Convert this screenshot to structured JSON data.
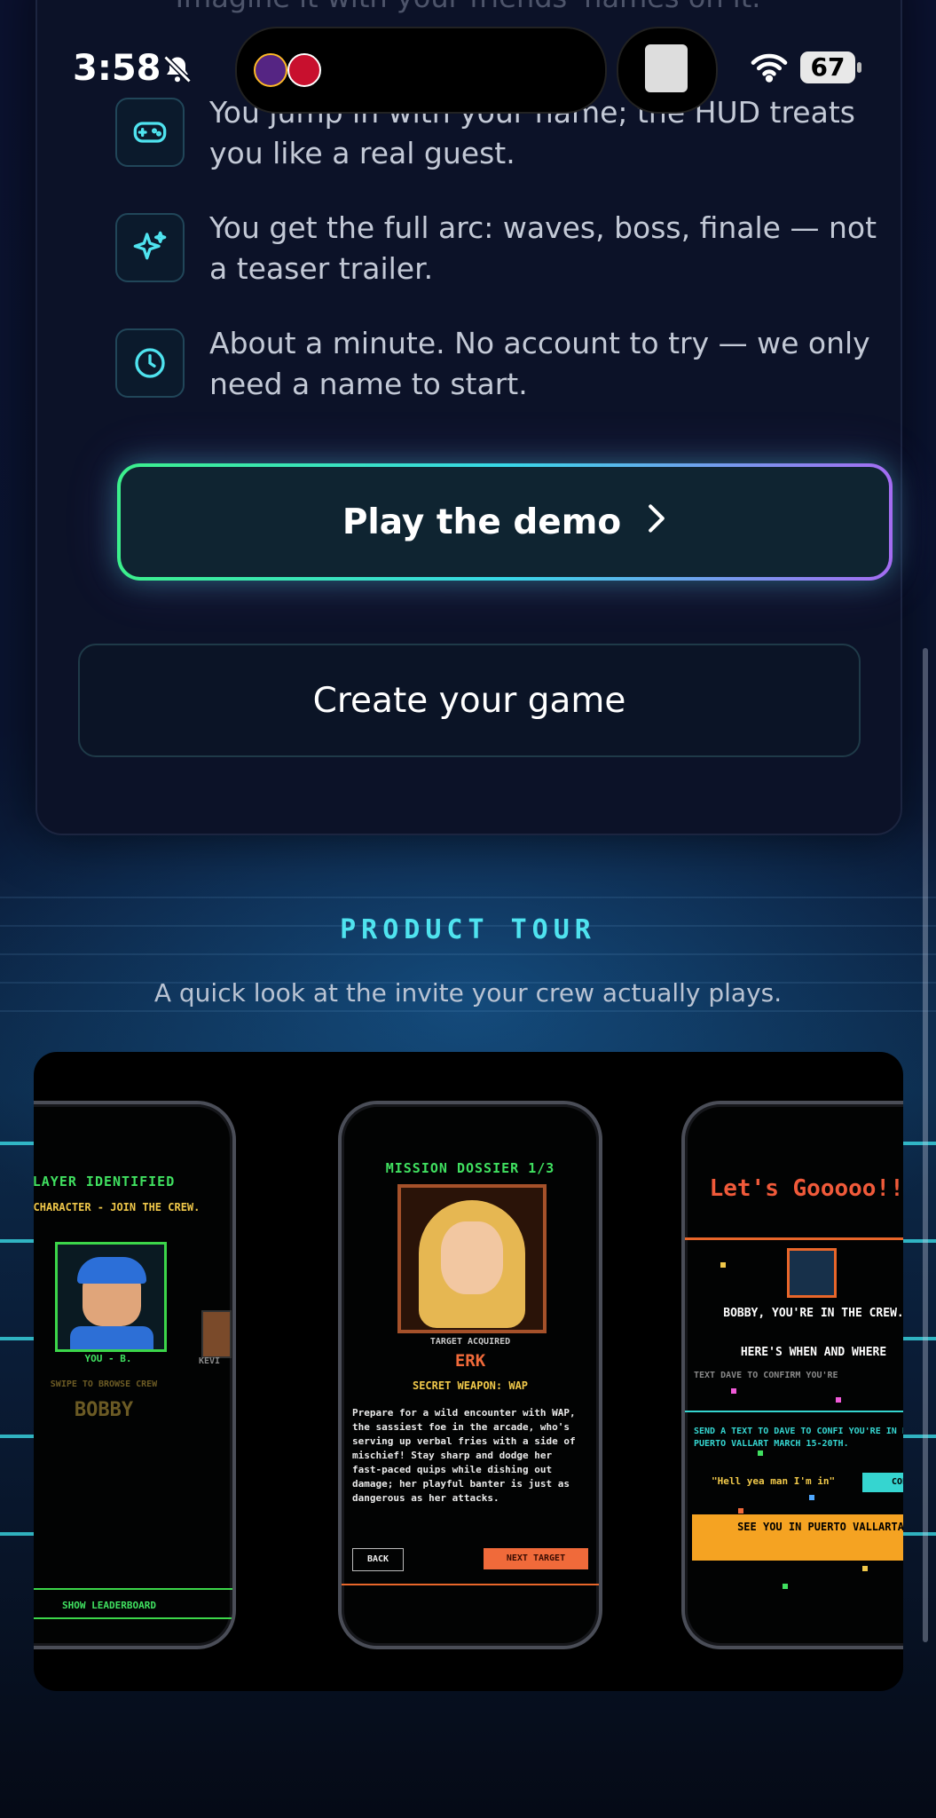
{
  "status_bar": {
    "time": "3:58",
    "battery": "67",
    "ghost_text": "Imagine it with your friends' names on it."
  },
  "features": [
    {
      "icon": "gamepad-icon",
      "text": "You jump in with your name; the HUD treats you like a real guest."
    },
    {
      "icon": "sparkles-icon",
      "text": "You get the full arc: waves, boss, finale — not a teaser trailer."
    },
    {
      "icon": "clock-icon",
      "text": "About a minute. No account to try — we only need a name to start."
    }
  ],
  "buttons": {
    "play_demo": "Play the demo",
    "create_game": "Create your game"
  },
  "tour": {
    "label": "PRODUCT TOUR",
    "subtitle": "A quick look at the invite your crew actually plays."
  },
  "phones": {
    "p1": {
      "title": "LAYER IDENTIFIED",
      "subtitle": "OUR CHARACTER - JOIN THE CREW.",
      "you_label": "YOU - B.",
      "kev_label": "KEVI",
      "swipe": "SWIPE TO BROWSE CREW",
      "name": "BOBBY",
      "leaderboard": "SHOW LEADERBOARD"
    },
    "p2": {
      "title": "MISSION DOSSIER 1/3",
      "target_acquired": "TARGET ACQUIRED",
      "target_name": "ERK",
      "secret": "SECRET WEAPON: WAP",
      "blurb": "Prepare for a wild encounter with WAP, the sassiest foe in the arcade, who's serving up verbal fries with a side of mischief! Stay sharp and dodge her fast-paced quips while dishing out damage; her playful banter is just as dangerous as her attacks.",
      "back": "BACK",
      "next": "NEXT TARGET"
    },
    "p3": {
      "headline": "Let's Gooooo!!!",
      "line1": "BOBBY, YOU'RE IN THE CREW.",
      "line2": "HERE'S WHEN AND WHERE",
      "small": "TEXT DAVE TO CONFIRM YOU'RE",
      "cyan": "SEND A TEXT TO DAVE TO CONFI YOU'RE IN FOR PUERTO VALLART MARCH 15-20TH.",
      "quote": "\"Hell yea man I'm in\"",
      "copy": "COPY",
      "banner": "SEE YOU IN PUERTO VALLARTA"
    }
  },
  "colors": {
    "accent_cyan": "#4fe3ef",
    "accent_green": "#3cf08c",
    "accent_purple": "#a46cf2",
    "background": "#070d1f"
  }
}
